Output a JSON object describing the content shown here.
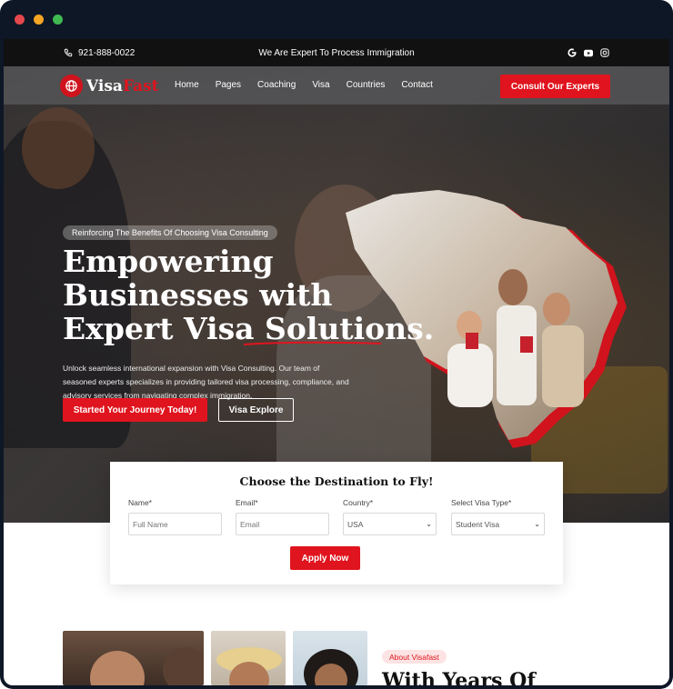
{
  "colors": {
    "brand_red": "#e0141e",
    "topbar_bg": "#111111",
    "frame_bg": "#0e1726"
  },
  "window": {
    "dots": [
      "#e5484d",
      "#f5a623",
      "#3fb950"
    ]
  },
  "topbar": {
    "phone_icon": "phone-icon",
    "phone": "921-888-0022",
    "tagline": "We Are Expert To Process Immigration",
    "social_icons": [
      "google-icon",
      "youtube-icon",
      "instagram-icon"
    ]
  },
  "nav": {
    "logo_main": "Visa",
    "logo_accent": "Fast",
    "logo_icon": "globe-icon",
    "items": [
      "Home",
      "Pages",
      "Coaching",
      "Visa",
      "Countries",
      "Contact"
    ],
    "cta": "Consult Our Experts"
  },
  "hero": {
    "eyebrow": "Reinforcing The Benefits Of Choosing Visa Consulting",
    "headline_lines": [
      "Empowering",
      "Businesses with",
      "Expert Visa Solutions."
    ],
    "description": "Unlock seamless international expansion with Visa Consulting. Our team of seasoned experts specializes in providing tailored visa processing, compliance, and advisory services from navigating complex immigration.",
    "primary_button": "Started Your Journey Today!",
    "secondary_button": "Visa Explore"
  },
  "form": {
    "title": "Choose the Destination to Fly!",
    "fields": [
      {
        "label": "Name*",
        "placeholder": "Full Name",
        "value": ""
      },
      {
        "label": "Email*",
        "placeholder": "Email",
        "value": ""
      },
      {
        "label": "Country*",
        "value": "USA"
      },
      {
        "label": "Select Visa Type*",
        "value": "Student Visa"
      }
    ],
    "submit": "Apply Now"
  },
  "about": {
    "badge": "About Visafast",
    "heading": "With Years Of"
  }
}
